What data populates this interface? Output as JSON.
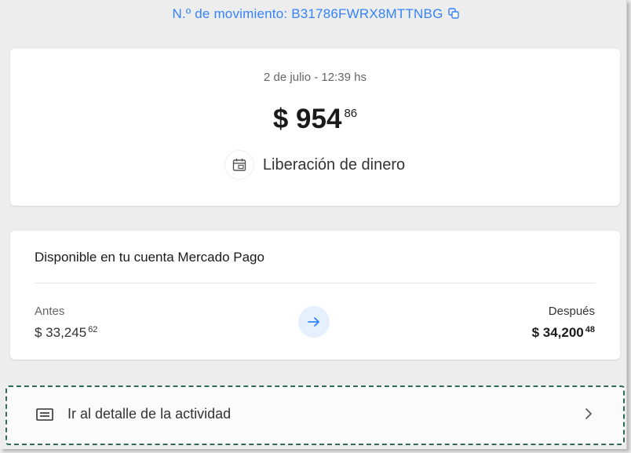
{
  "header": {
    "movement_text": "N.º de movimiento: B31786FWRX8MTTNBG"
  },
  "summary": {
    "date": "2 de julio - 12:39 hs",
    "amount_main": "$ 954",
    "amount_cents": "86",
    "type_label": "Liberación de dinero"
  },
  "balance": {
    "title": "Disponible en tu cuenta Mercado Pago",
    "before_label": "Antes",
    "before_value": "$ 33,245",
    "before_cents": "62",
    "after_label": "Después",
    "after_value": "$ 34,200",
    "after_cents": "48"
  },
  "detail_link": {
    "label": "Ir al detalle de la actividad"
  },
  "colors": {
    "accent": "#3483fa",
    "background": "#ededed",
    "card": "#ffffff",
    "focus_outline": "#2f6b54"
  },
  "icons": [
    "copy-icon",
    "calendar-money-icon",
    "arrow-right-icon",
    "receipt-icon",
    "chevron-right-icon"
  ]
}
